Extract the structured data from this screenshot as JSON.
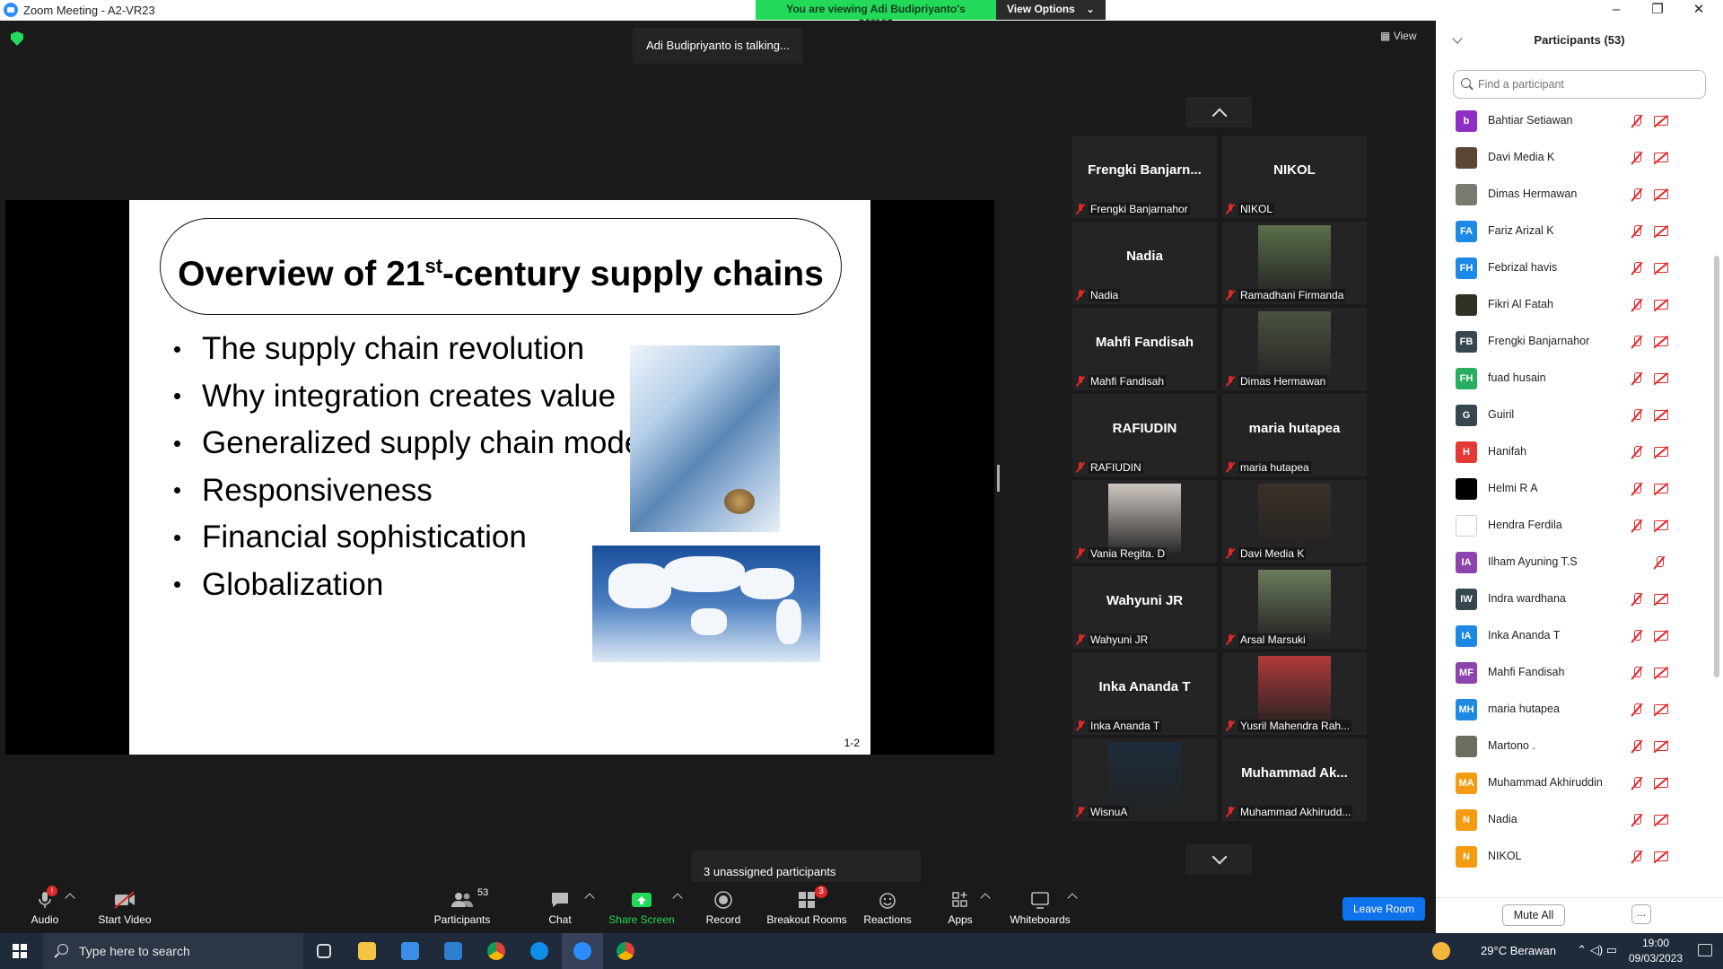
{
  "window": {
    "title": "Zoom Meeting - A2-VR23",
    "banner_viewing": "You are viewing Adi Budipriyanto's screen",
    "banner_options": "View Options",
    "minimize": "–",
    "maximize": "❐",
    "close": "✕"
  },
  "stage": {
    "talking": "Adi Budipriyanto is talking...",
    "view_label": "View",
    "unassigned": "3 unassigned participants"
  },
  "slide": {
    "title_pre": "Overview of 21",
    "title_sup": "st",
    "title_post": "-century supply chains",
    "bullets": [
      "The supply chain revolution",
      "Why integration creates value",
      "Generalized supply chain model",
      "Responsiveness",
      "Financial sophistication",
      "Globalization"
    ],
    "page": "1-2"
  },
  "tiles": [
    {
      "big": "Frengki  Banjarn...",
      "foot": "Frengki Banjarnahor"
    },
    {
      "big": "NIKOL",
      "foot": "NIKOL"
    },
    {
      "big": "Nadia",
      "foot": "Nadia"
    },
    {
      "big": "",
      "foot": "Ramadhani Firmanda"
    },
    {
      "big": "Mahfi Fandisah",
      "foot": "Mahfi Fandisah"
    },
    {
      "big": "",
      "foot": "Dimas Hermawan"
    },
    {
      "big": "RAFIUDIN",
      "foot": "RAFIUDIN"
    },
    {
      "big": "maria hutapea",
      "foot": "maria hutapea"
    },
    {
      "big": "",
      "foot": "Vania Regita. D"
    },
    {
      "big": "",
      "foot": "Davi Media K"
    },
    {
      "big": "Wahyuni JR",
      "foot": "Wahyuni JR"
    },
    {
      "big": "",
      "foot": "Arsal Marsuki"
    },
    {
      "big": "Inka Ananda T",
      "foot": "Inka Ananda T"
    },
    {
      "big": "",
      "foot": "Yusril Mahendra Rah..."
    },
    {
      "big": "",
      "foot": "WisnuA"
    },
    {
      "big": "Muhammad  Ak...",
      "foot": "Muhammad Akhirudd..."
    }
  ],
  "toolbar": {
    "audio": "Audio",
    "audio_badge": "!",
    "start_video": "Start Video",
    "participants": "Participants",
    "participants_count": "53",
    "chat": "Chat",
    "share_screen": "Share Screen",
    "record": "Record",
    "breakout_rooms": "Breakout Rooms",
    "breakout_badge": "3",
    "reactions": "Reactions",
    "apps": "Apps",
    "whiteboards": "Whiteboards",
    "leave": "Leave Room"
  },
  "panel": {
    "title": "Participants (53)",
    "search_placeholder": "Find a participant",
    "mute_all": "Mute All",
    "more": "...",
    "participants": [
      {
        "initials": "b",
        "name": "Bahtiar Setiawan",
        "color": "#8e2fc4"
      },
      {
        "initials": "",
        "name": "Davi Media K",
        "color": "#5b4636"
      },
      {
        "initials": "",
        "name": "Dimas Hermawan",
        "color": "#7a7a70"
      },
      {
        "initials": "FA",
        "name": "Fariz Arizal K",
        "color": "#1e88e5"
      },
      {
        "initials": "FH",
        "name": "Febrizal havis",
        "color": "#1e88e5"
      },
      {
        "initials": "",
        "name": "Fikri Al Fatah",
        "color": "#2f3324"
      },
      {
        "initials": "FB",
        "name": "Frengki Banjarnahor",
        "color": "#37474f"
      },
      {
        "initials": "FH",
        "name": "fuad husain",
        "color": "#27ae60"
      },
      {
        "initials": "G",
        "name": "Guiril",
        "color": "#37474f"
      },
      {
        "initials": "H",
        "name": "Hanifah",
        "color": "#e53935"
      },
      {
        "initials": "",
        "name": "Helmi R A",
        "color": "#000000"
      },
      {
        "initials": "",
        "name": "Hendra Ferdila",
        "color": "#ffffff"
      },
      {
        "initials": "IA",
        "name": "Ilham Ayuning T.S",
        "color": "#8e44ad"
      },
      {
        "initials": "IW",
        "name": "Indra wardhana",
        "color": "#37474f"
      },
      {
        "initials": "IA",
        "name": "Inka Ananda T",
        "color": "#1e88e5"
      },
      {
        "initials": "MF",
        "name": "Mahfi Fandisah",
        "color": "#8e44ad"
      },
      {
        "initials": "MH",
        "name": "maria hutapea",
        "color": "#1e88e5"
      },
      {
        "initials": "",
        "name": "Martono .",
        "color": "#6d6d5f"
      },
      {
        "initials": "MA",
        "name": "Muhammad Akhiruddin",
        "color": "#f39c12"
      },
      {
        "initials": "N",
        "name": "Nadia",
        "color": "#f39c12"
      },
      {
        "initials": "N",
        "name": "NIKOL",
        "color": "#f39c12"
      }
    ]
  },
  "taskbar": {
    "search": "Type here to search",
    "weather": "29°C  Berawan",
    "time": "19:00",
    "date": "09/03/2023"
  }
}
